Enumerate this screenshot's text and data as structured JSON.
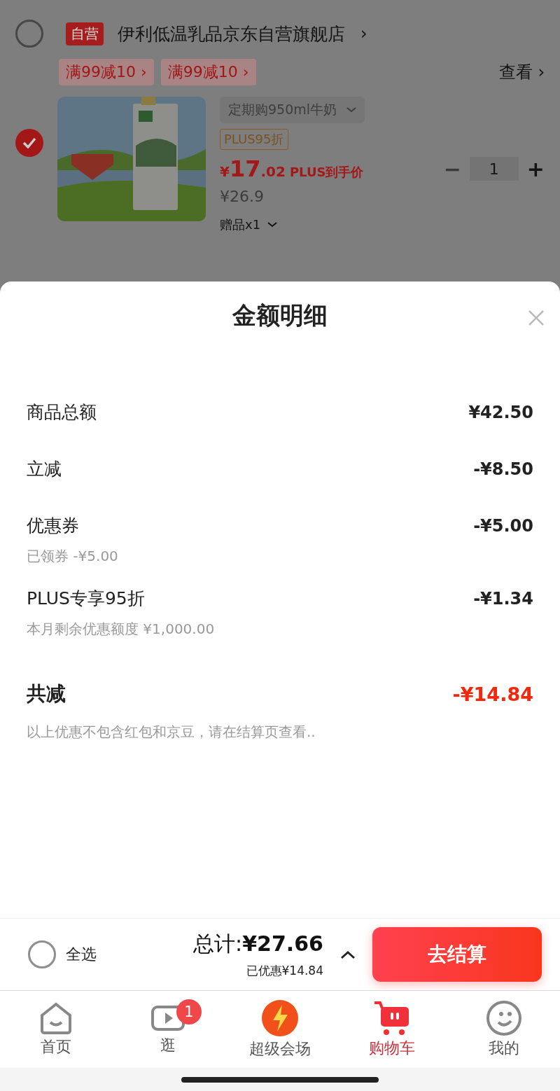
{
  "cart": {
    "store": {
      "selected": false,
      "badge": "自营",
      "name": "伊利低温乳品京东自营旗舰店",
      "arrow": "›"
    },
    "promos": [
      {
        "label": "满99减10",
        "arrow": "›"
      },
      {
        "label": "满99减10",
        "arrow": "›"
      }
    ],
    "view": {
      "label": "查看",
      "arrow": "›"
    },
    "item": {
      "selected": true,
      "spec": "定期购950ml牛奶",
      "tag": "PLUS95折",
      "price_symbol": "¥",
      "price_int": "17",
      "price_dec": ".02",
      "price_note": "PLUS到手价",
      "original_price": "¥26.9",
      "gift": "赠品x1",
      "minus": "−",
      "minus_disabled": true,
      "quantity": "1",
      "plus": "+"
    }
  },
  "sheet": {
    "title": "金额明细",
    "rows": [
      {
        "label": "商品总额",
        "value": "¥42.50"
      },
      {
        "label": "立减",
        "value": "-¥8.50"
      },
      {
        "label": "优惠券",
        "value": "-¥5.00",
        "note": "已领券 -¥5.00"
      },
      {
        "label": "PLUS专享95折",
        "value": "-¥1.34",
        "note": "本月剩余优惠额度 ¥1,000.00"
      }
    ],
    "total": {
      "label": "共减",
      "value": "-¥14.84"
    },
    "footnote": "以上优惠不包含红包和京豆，请在结算页查看.."
  },
  "bottom_bar": {
    "select_all": {
      "selected": false,
      "label": "全选"
    },
    "total_label": "总计:",
    "total_value": "¥27.66",
    "saved": "已优惠¥14.84",
    "expanded": true,
    "checkout": "去结算"
  },
  "tabs": [
    {
      "kind": "home",
      "label": "首页",
      "selected": false
    },
    {
      "kind": "video",
      "label": "逛",
      "selected": false,
      "badge": "1"
    },
    {
      "kind": "sale",
      "label": "超级会场",
      "selected": false
    },
    {
      "kind": "cart",
      "label": "购物车",
      "selected": true
    },
    {
      "kind": "profile",
      "label": "我的",
      "selected": false
    }
  ]
}
